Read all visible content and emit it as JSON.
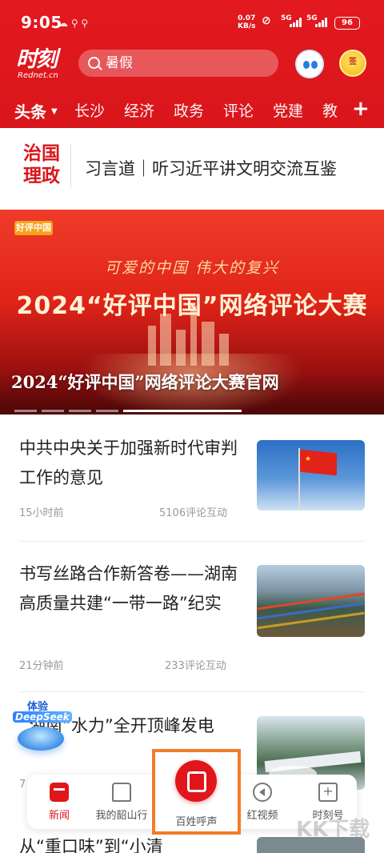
{
  "status_bar": {
    "time": "9:05",
    "net_speed": "0.07",
    "net_unit": "KB/s",
    "sim1": "5G",
    "sim2": "5G",
    "battery": "96"
  },
  "header": {
    "logo": "时刻",
    "logo_sub": "Rednet.cn",
    "search_placeholder": "暑假",
    "checkin_label": "签"
  },
  "tabs": [
    "头条",
    "长沙",
    "经济",
    "政务",
    "评论",
    "党建",
    "教"
  ],
  "governance": {
    "logo_line1": "治国",
    "logo_line2": "理政",
    "headline": "习言道｜听习近平讲文明交流互鉴"
  },
  "banner": {
    "logo": "好评中国",
    "subtitle": "可爱的中国  伟大的复兴",
    "big_title": "2024“好评中国”网络评论大赛",
    "caption": "2024“好评中国”网络评论大赛官网"
  },
  "news": [
    {
      "title": "中共中央关于加强新时代审判工作的意见",
      "time": "15小时前",
      "comments": "5106评论互动"
    },
    {
      "title": "书写丝路合作新答卷——湖南高质量共建“一带一路”纪实",
      "time": "21分钟前",
      "comments": "233评论互动"
    },
    {
      "title": "湖南“水力”全开顶峰发电",
      "time": "7"
    },
    {
      "title": "从“重口味”到“小清"
    }
  ],
  "deepseek": {
    "line1": "体验",
    "line2": "DeepSeek"
  },
  "tabbar": {
    "news": "新闻",
    "shaoshan": "我的韶山行",
    "voice": "百姓呼声",
    "video": "红视频",
    "moment": "时刻号"
  },
  "watermark": "KK下载",
  "colors": {
    "brand_red": "#e0161b",
    "highlight_orange": "#f47b28"
  }
}
